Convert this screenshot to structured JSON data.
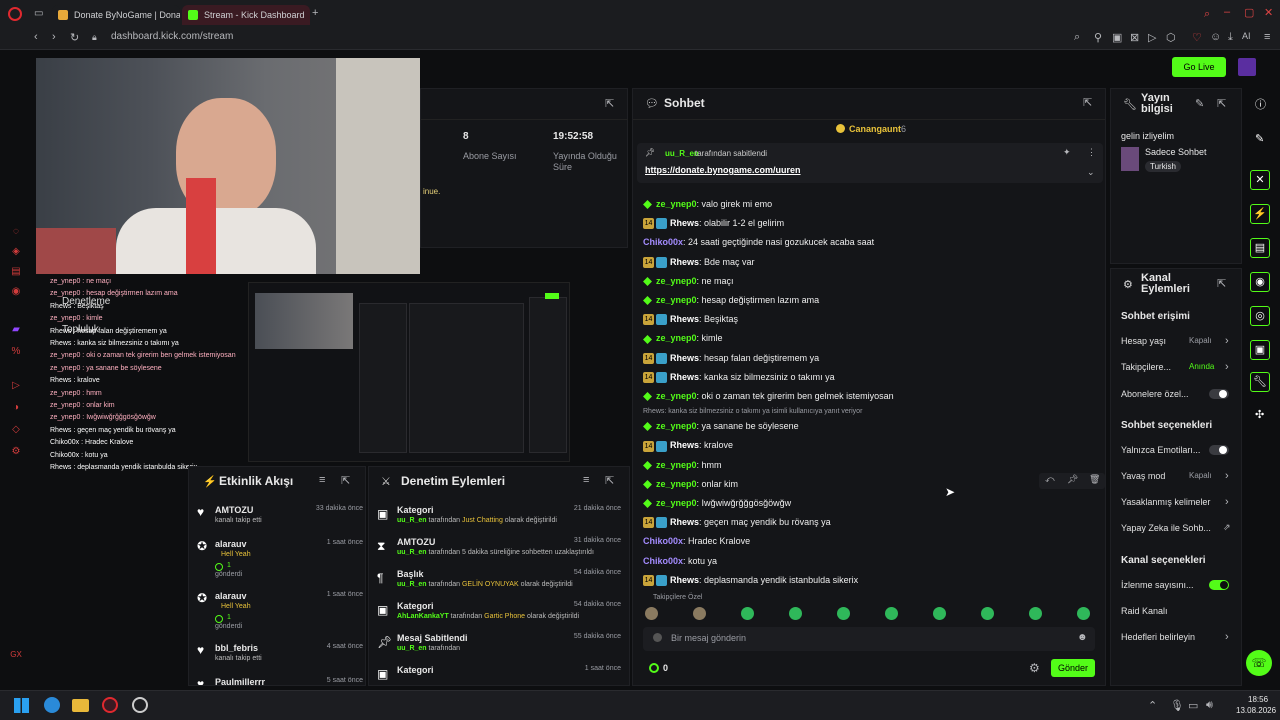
{
  "browser": {
    "tabs": [
      {
        "label": "Donate ByNoGame | Donat",
        "active": false
      },
      {
        "label": "Stream - Kick Dashboard",
        "active": true
      }
    ],
    "url": "dashboard.kick.com/stream",
    "new_tab": "+"
  },
  "header": {
    "go_live": "Go Live"
  },
  "stats": {
    "subs_value": "8",
    "subs_label": "Abone Sayısı",
    "time_value": "19:52:58",
    "time_label": "Yayında Olduğu Süre"
  },
  "stream_preview": {
    "partial_text": "inue."
  },
  "overlay_chat": {
    "titles": [
      "Denetleme",
      "Topluluk"
    ],
    "lines": [
      "ze_ynep0 : ne maçı",
      "ze_ynep0 : hesap değiştirmen lazım ama",
      "Rhews : Beşiktaş",
      "ze_ynep0 : kimle",
      "Rhews : hesap falan değiştiremem ya",
      "Rhews : kanka siz bilmezsiniz o takımı ya",
      "ze_ynep0 : oki o zaman tek girerim ben gelmek istemiyosan",
      "ze_ynep0 : ya sanane be söylesene",
      "Rhews : kralove",
      "ze_ynep0 : hmm",
      "ze_ynep0 : onlar kim",
      "ze_ynep0 : Iwğwiwğrğğgösğöwğw",
      "Rhews : geçen maç yendik bu rövanş ya",
      "Chiko00x : Hradec Kralove",
      "Chiko00x : kotu ya",
      "Rhews : deplasmanda yendik istanbulda sikerix"
    ]
  },
  "activity": {
    "title": "Etkinlik Akışı",
    "items": [
      {
        "user": "AMTOZU",
        "desc": "kanalı takip etti",
        "time": "33 dakika önce",
        "extra": "",
        "extra2": ""
      },
      {
        "user": "alarauv",
        "desc": "Hell Yeah",
        "time": "1 saat önce",
        "extra": "1",
        "extra2": "gönderdi"
      },
      {
        "user": "alarauv",
        "desc": "Hell Yeah",
        "time": "1 saat önce",
        "extra": "1",
        "extra2": "gönderdi"
      },
      {
        "user": "bbl_febris",
        "desc": "kanalı takip etti",
        "time": "4 saat önce",
        "extra": "",
        "extra2": ""
      },
      {
        "user": "Paulmillerrr",
        "desc": "",
        "time": "5 saat önce",
        "extra": "",
        "extra2": ""
      }
    ]
  },
  "moderation": {
    "title": "Denetim Eylemleri",
    "items": [
      {
        "type": "Kategori",
        "time": "21 dakika önce",
        "user": "uu_R_en",
        "pre": " tarafından ",
        "hl": "Just Chatting",
        "post": " olarak değiştirildi"
      },
      {
        "type": "AMTOZU",
        "time": "31 dakika önce",
        "user": "uu_R_en",
        "pre": " tarafından 5 dakika süreliğine sohbetten uzaklaştırıldı",
        "hl": "",
        "post": ""
      },
      {
        "type": "Başlık",
        "time": "54 dakika önce",
        "user": "uu_R_en",
        "pre": " tarafından ",
        "hl": "GELİN OYNUYAK",
        "post": " olarak değiştirildi"
      },
      {
        "type": "Kategori",
        "time": "54 dakika önce",
        "user": "AhLanKankaYT",
        "pre": " tarafından ",
        "hl": "Gartic Phone",
        "post": " olarak değiştirildi"
      },
      {
        "type": "Mesaj Sabitlendi",
        "time": "55 dakika önce",
        "user": "uu_R_en",
        "pre": " tarafından",
        "hl": "",
        "post": ""
      },
      {
        "type": "Kategori",
        "time": "1 saat önce",
        "user": "",
        "pre": "",
        "hl": "",
        "post": ""
      }
    ]
  },
  "chat": {
    "title": "Sohbet",
    "viewer_name": "Canangaunt",
    "viewer_count": "6",
    "pinned_by": "uu_R_en",
    "pinned_suffix": "tarafından sabitlendi",
    "pinned_link": "https://donate.bynogame.com/uuren",
    "messages": [
      {
        "user": "ze_ynep0",
        "text": "valo girek mi emo",
        "kind": "green"
      },
      {
        "user": "Rhews",
        "text": "olabilir 1-2 el gelirim",
        "kind": "sub"
      },
      {
        "user": "Chiko00x",
        "text": "24 saati geçtiğinde nasi gozukucek acaba saat",
        "kind": "purple"
      },
      {
        "user": "Rhews",
        "text": "Bde maç var",
        "kind": "sub"
      },
      {
        "user": "ze_ynep0",
        "text": "ne maçı",
        "kind": "green"
      },
      {
        "user": "ze_ynep0",
        "text": "hesap değiştirmen lazım ama",
        "kind": "green"
      },
      {
        "user": "Rhews",
        "text": "Beşiktaş",
        "kind": "sub"
      },
      {
        "user": "ze_ynep0",
        "text": "kimle",
        "kind": "green"
      },
      {
        "user": "Rhews",
        "text": "hesap falan değiştiremem ya",
        "kind": "sub"
      },
      {
        "user": "Rhews",
        "text": "kanka siz bilmezsiniz o takımı ya",
        "kind": "sub"
      },
      {
        "user": "ze_ynep0",
        "text": "oki o zaman tek girerim ben gelmek istemiyosan",
        "kind": "green"
      },
      {
        "user": "ze_ynep0",
        "text": "ya sanane be söylesene",
        "kind": "green",
        "reply": "Rhews: kanka siz bilmezsiniz o takımı ya isimli kullanıcıya yanıt veriyor"
      },
      {
        "user": "Rhews",
        "text": "kralove",
        "kind": "sub"
      },
      {
        "user": "ze_ynep0",
        "text": "hmm",
        "kind": "green"
      },
      {
        "user": "ze_ynep0",
        "text": "onlar kim",
        "kind": "green"
      },
      {
        "user": "ze_ynep0",
        "text": "Iwğwiwğrğğgösğöwğw",
        "kind": "green"
      },
      {
        "user": "Rhews",
        "text": "geçen maç yendik bu rövanş ya",
        "kind": "sub"
      },
      {
        "user": "Chiko00x",
        "text": "Hradec Kralove",
        "kind": "purple"
      },
      {
        "user": "Chiko00x",
        "text": "kotu ya",
        "kind": "purple"
      },
      {
        "user": "Rhews",
        "text": "deplasmanda yendik istanbulda sikerix",
        "kind": "sub"
      }
    ],
    "sub_badge": "14",
    "emote_label": "Takipçilere Özel",
    "input_placeholder": "Bir mesaj gönderin",
    "points": "0",
    "send": "Gönder"
  },
  "stream_info": {
    "title_line1": "Yayın",
    "title_line2": "bilgisi",
    "stream_title": "gelin izliyelim",
    "category": "Sadece Sohbet",
    "tag": "Turkish"
  },
  "channel_actions": {
    "title_line1": "Kanal",
    "title_line2": "Eylemleri",
    "chat_access": "Sohbet erişimi",
    "account_age": "Hesap yaşı",
    "account_age_val": "Kapalı",
    "followers": "Takipçilere...",
    "followers_val": "Anında",
    "subs_only": "Abonelere özel...",
    "chat_options": "Sohbet seçenekleri",
    "emotes_only": "Yalnızca Emotiları...",
    "slow_mode": "Yavaş mod",
    "slow_mode_val": "Kapalı",
    "banned_words": "Yasaklanmış kelimeler",
    "ai_moderation": "Yapay Zeka ile Sohb...",
    "channel_options": "Kanal seçenekleri",
    "viewer_count": "İzlenme sayısını...",
    "raid": "Raid Kanalı",
    "goals": "Hedefleri belirleyin"
  },
  "taskbar": {
    "time": "18:56",
    "date": "13.08.2026"
  },
  "colors": {
    "accent": "#53fc18",
    "bg": "#0d0e10",
    "panel": "#141518"
  }
}
